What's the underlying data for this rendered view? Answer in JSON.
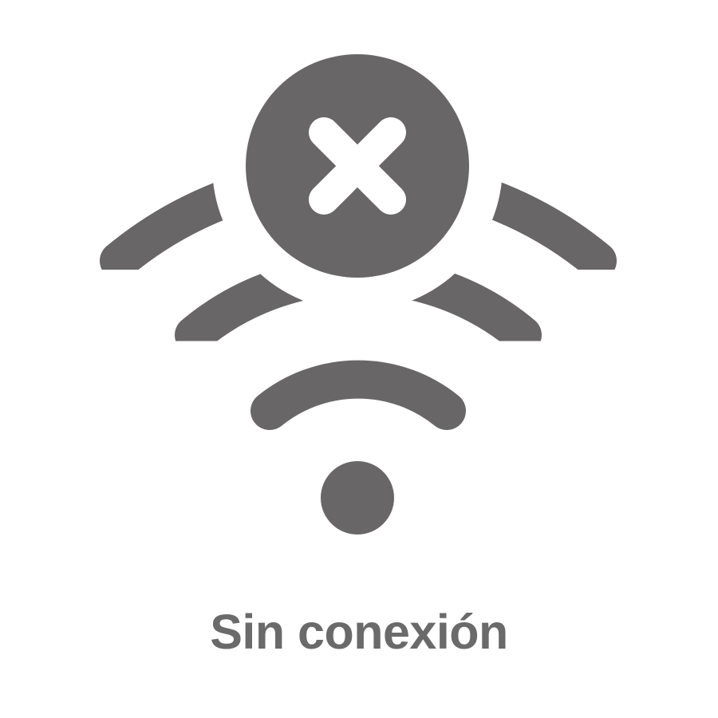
{
  "status": {
    "label": "Sin conexión",
    "icon": "wifi-off-icon",
    "badge_icon": "close-icon"
  },
  "colors": {
    "icon": "#686667",
    "text": "#6b6a6b",
    "background": "#ffffff"
  }
}
